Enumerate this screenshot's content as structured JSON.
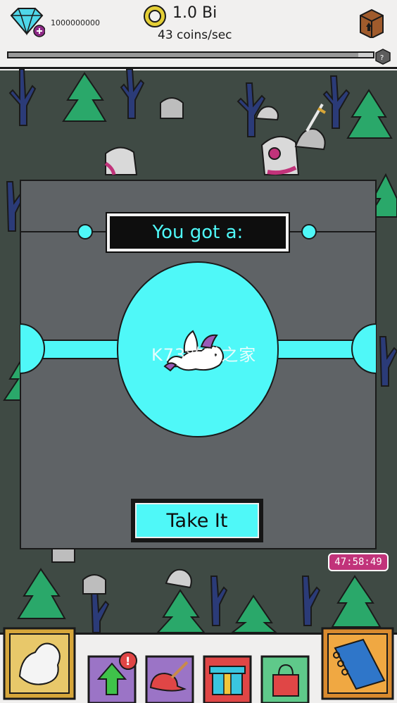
{
  "hud": {
    "gem_count": "1000000000",
    "coin_amount": "1.0 Bi",
    "coin_rate": "43 coins/sec",
    "progress_fraction": 0.96
  },
  "dialog": {
    "title": "You got a:",
    "button_label": "Take It",
    "accent_color": "#4ff8f8"
  },
  "event_timer": "47:58:49",
  "watermark": "K73游戏之家",
  "bottom_menu": [
    {
      "name": "dragon-collection-button",
      "icon": "dragon-icon"
    },
    {
      "name": "upgrades-button",
      "icon": "green-arrow-up-icon",
      "badge": "!"
    },
    {
      "name": "customize-button",
      "icon": "cap-brush-icon"
    },
    {
      "name": "gifts-button",
      "icon": "gift-box-icon"
    },
    {
      "name": "shop-button",
      "icon": "shopping-bag-icon"
    },
    {
      "name": "dragon-book-button",
      "icon": "book-icon"
    }
  ]
}
